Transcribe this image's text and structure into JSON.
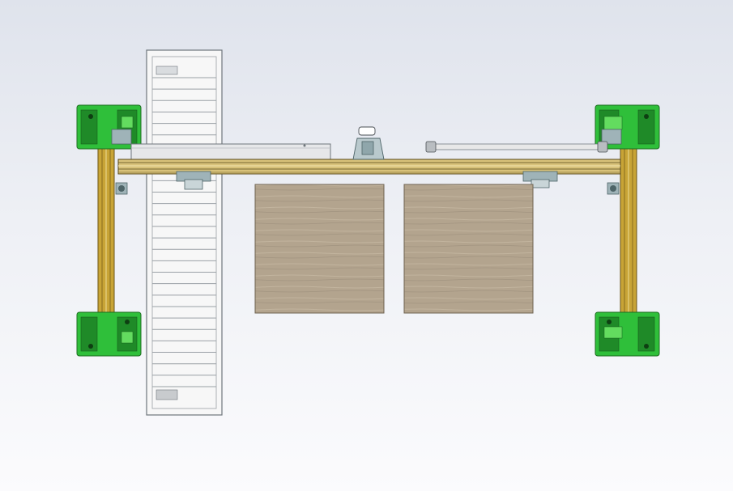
{
  "scene": {
    "view": "top",
    "background_top": "#dfe3ec",
    "background_bottom": "#fbfbfd"
  },
  "colors": {
    "corner_mount": "#2fbf3a",
    "corner_mount_dark": "#1f8a28",
    "corner_mount_light": "#63dc5f",
    "rail": "#c8a436",
    "rail_dark": "#6b5516",
    "beam": "#d8c27a",
    "beam_dark": "#5a4a1a",
    "conveyor_frame": "#f7f7f7",
    "conveyor_line": "#9aa0a6",
    "carriage": "#9fb3b8",
    "carriage_dark": "#4e6468",
    "wood_panel": "#b3a48e",
    "wood_panel_edge": "#6f6352",
    "rod": "#e8e8e8"
  },
  "components": {
    "corner_mounts": [
      "top-left",
      "top-right",
      "bottom-left",
      "bottom-right"
    ],
    "side_rails": [
      "left",
      "right"
    ],
    "wood_panels": [
      "left",
      "right"
    ],
    "conveyor_slat_count": 28
  }
}
